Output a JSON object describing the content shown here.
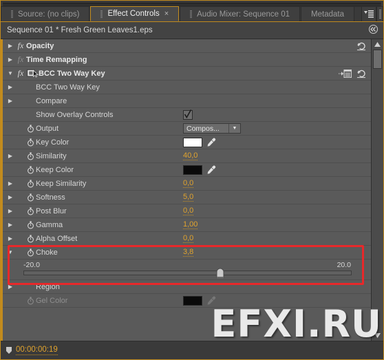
{
  "window": {
    "accent_color": "#c28b1d",
    "panel_bg": "#5a5a5a",
    "value_color": "#e0a32e",
    "annotation_color": "#e8282a"
  },
  "tabs": [
    {
      "label": "Source: (no clips)",
      "active": false,
      "closable": false
    },
    {
      "label": "Effect Controls",
      "active": true,
      "closable": true
    },
    {
      "label": "Audio Mixer: Sequence 01",
      "active": false,
      "closable": false
    },
    {
      "label": "Metadata",
      "active": false,
      "closable": false
    }
  ],
  "tab_close_glyph": "×",
  "panel_menu_icon": "panel-menu-icon",
  "panel_grip_icon": "panel-grip-icon",
  "clip_header": {
    "title": "Sequence 01 * Fresh Green Leaves1.eps",
    "collapse_glyph": "«"
  },
  "rows": [
    {
      "name": "opacity",
      "label": "Opacity",
      "indent": 0,
      "twirl": "closed",
      "fx": true,
      "fx_dim": false,
      "bold": true,
      "stopwatch": false,
      "value_type": "none",
      "reset": true
    },
    {
      "name": "time-remapping",
      "label": "Time Remapping",
      "indent": 0,
      "twirl": "closed",
      "fx": true,
      "fx_dim": true,
      "bold": true,
      "stopwatch": false,
      "value_type": "none",
      "reset": false
    },
    {
      "name": "bcc-two-way-key",
      "label": "BCC Two Way Key",
      "indent": 0,
      "twirl": "open",
      "fx": true,
      "fx_dim": false,
      "bold": true,
      "stopwatch": false,
      "value_type": "none",
      "reset": true,
      "effect_icon": true,
      "setup_icon": true
    },
    {
      "name": "bcc-two-way-key-group",
      "label": "BCC Two Way Key",
      "indent": 1,
      "twirl": "closed",
      "fx": false,
      "fx_dim": false,
      "bold": false,
      "stopwatch": false,
      "value_type": "none",
      "reset": false
    },
    {
      "name": "compare",
      "label": "Compare",
      "indent": 1,
      "twirl": "closed",
      "fx": false,
      "fx_dim": false,
      "bold": false,
      "stopwatch": false,
      "value_type": "none",
      "reset": false
    },
    {
      "name": "show-overlay-controls",
      "label": "Show Overlay Controls",
      "indent": 1,
      "twirl": "none",
      "fx": false,
      "fx_dim": false,
      "bold": false,
      "stopwatch": false,
      "value_type": "checkbox",
      "checked": true,
      "reset": false
    },
    {
      "name": "output",
      "label": "Output",
      "indent": 1,
      "twirl": "none",
      "fx": false,
      "fx_dim": false,
      "bold": false,
      "stopwatch": true,
      "value_type": "dropdown",
      "value": "Compos...",
      "reset": false
    },
    {
      "name": "key-color",
      "label": "Key Color",
      "indent": 1,
      "twirl": "none",
      "fx": false,
      "fx_dim": false,
      "bold": false,
      "stopwatch": true,
      "value_type": "color",
      "value": "#ffffff",
      "reset": false
    },
    {
      "name": "similarity",
      "label": "Similarity",
      "indent": 1,
      "twirl": "closed",
      "fx": false,
      "fx_dim": false,
      "bold": false,
      "stopwatch": true,
      "value_type": "number",
      "value": "40,0",
      "reset": false
    },
    {
      "name": "keep-color",
      "label": "Keep Color",
      "indent": 1,
      "twirl": "none",
      "fx": false,
      "fx_dim": false,
      "bold": false,
      "stopwatch": true,
      "value_type": "color",
      "value": "#0a0a0a",
      "reset": false
    },
    {
      "name": "keep-similarity",
      "label": "Keep Similarity",
      "indent": 1,
      "twirl": "closed",
      "fx": false,
      "fx_dim": false,
      "bold": false,
      "stopwatch": true,
      "value_type": "number",
      "value": "0,0",
      "reset": false
    },
    {
      "name": "softness",
      "label": "Softness",
      "indent": 1,
      "twirl": "closed",
      "fx": false,
      "fx_dim": false,
      "bold": false,
      "stopwatch": true,
      "value_type": "number",
      "value": "5,0",
      "reset": false
    },
    {
      "name": "post-blur",
      "label": "Post Blur",
      "indent": 1,
      "twirl": "closed",
      "fx": false,
      "fx_dim": false,
      "bold": false,
      "stopwatch": true,
      "value_type": "number",
      "value": "0,0",
      "reset": false
    },
    {
      "name": "gamma",
      "label": "Gamma",
      "indent": 1,
      "twirl": "closed",
      "fx": false,
      "fx_dim": false,
      "bold": false,
      "stopwatch": true,
      "value_type": "number",
      "value": "1,00",
      "reset": false
    },
    {
      "name": "alpha-offset",
      "label": "Alpha Offset",
      "indent": 1,
      "twirl": "closed",
      "fx": false,
      "fx_dim": false,
      "bold": false,
      "stopwatch": true,
      "value_type": "number",
      "value": "0,0",
      "reset": false
    },
    {
      "name": "choke",
      "label": "Choke",
      "indent": 1,
      "twirl": "open",
      "fx": false,
      "fx_dim": false,
      "bold": false,
      "stopwatch": true,
      "value_type": "number",
      "value": "3,8",
      "reset": false,
      "highlighted": true
    },
    {
      "name": "choke-slider",
      "type": "slider",
      "min_label": "-20.0",
      "max_label": "20.0",
      "min": -20,
      "max": 20,
      "value": 3.8,
      "highlighted": true
    },
    {
      "name": "region",
      "label": "Region",
      "indent": 1,
      "twirl": "closed",
      "fx": false,
      "fx_dim": false,
      "bold": false,
      "stopwatch": false,
      "value_type": "none",
      "reset": false
    },
    {
      "name": "gel-color",
      "label": "Gel Color",
      "indent": 1,
      "twirl": "none",
      "fx": false,
      "fx_dim": false,
      "bold": false,
      "stopwatch": true,
      "sw_dim": true,
      "dim": true,
      "value_type": "color",
      "value": "#0a0a0a",
      "reset": false
    }
  ],
  "scrollbar": {
    "up_arrow": "scroll-up-icon",
    "down_arrow": "scroll-down-icon",
    "thumb_top_pct": 0,
    "thumb_height_pct": 8
  },
  "footer": {
    "timecode": "00:00:00:19",
    "marker_icon": "playhead-marker-icon"
  },
  "watermark": {
    "text": "EFXI.RU"
  }
}
